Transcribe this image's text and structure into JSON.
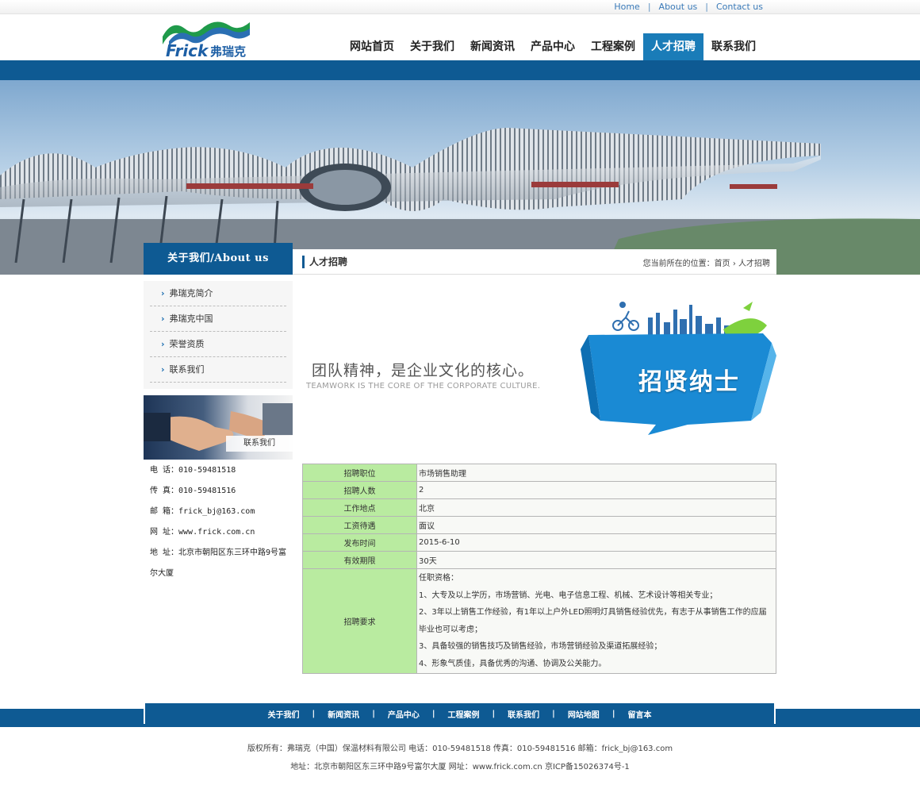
{
  "top_links": [
    "Home",
    "About us",
    "Contact us"
  ],
  "logo": {
    "text_en": "Frick",
    "text_cn": "弗瑞克"
  },
  "nav": {
    "items": [
      "网站首页",
      "关于我们",
      "新闻资讯",
      "产品中心",
      "工程案例",
      "人才招聘",
      "联系我们"
    ],
    "active_index": 5
  },
  "sidebar": {
    "title": "关于我们/About us",
    "items": [
      "弗瑞克简介",
      "弗瑞克中国",
      "荣誉资质",
      "联系我们"
    ],
    "contact_image_label": "联系我们",
    "contact": {
      "phone": "电 话：010-59481518",
      "fax": "传 真：010-59481516",
      "email": "邮 箱：frick_bj@163.com",
      "site": "网 址：www.frick.com.cn",
      "address": "地 址：北京市朝阳区东三环中路9号富尔大厦"
    }
  },
  "breadcrumb": {
    "title": "人才招聘",
    "prefix": "您当前所在的位置：",
    "home": "首页",
    "current": "人才招聘"
  },
  "recruit_banner": {
    "slogan": "团队精神，是企业文化的核心。",
    "slogan_en": "TEAMWORK IS THE CORE OF THE CORPORATE CULTURE.",
    "badge": "招贤纳士"
  },
  "job": {
    "rows": [
      {
        "label": "招聘职位",
        "value": "市场销售助理"
      },
      {
        "label": "招聘人数",
        "value": "2"
      },
      {
        "label": "工作地点",
        "value": "北京"
      },
      {
        "label": "工资待遇",
        "value": "面议"
      },
      {
        "label": "发布时间",
        "value": "2015-6-10"
      },
      {
        "label": "有效期限",
        "value": "30天"
      }
    ],
    "requirements_label": "招聘要求",
    "requirements": [
      "任职资格：",
      "1、大专及以上学历，市场营销、光电、电子信息工程、机械、艺术设计等相关专业；",
      "2、3年以上销售工作经验，有1年以上户外LED照明灯具销售经验优先，有志于从事销售工作的应届毕业也可以考虑；",
      "3、具备较强的销售技巧及销售经验，市场营销经验及渠道拓展经验；",
      "4、形象气质佳，具备优秀的沟通、协调及公关能力。"
    ]
  },
  "footer": {
    "nav": [
      "关于我们",
      "新闻资讯",
      "产品中心",
      "工程案例",
      "联系我们",
      "网站地图",
      "留言本"
    ],
    "copyright": "版权所有：弗瑞克（中国）保温材料有限公司 电话：010-59481518 传真：010-59481516 邮箱：frick_bj@163.com",
    "address": "地址：北京市朝阳区东三环中路9号富尔大厦 网址：www.frick.com.cn 京ICP备15026374号-1"
  },
  "colors": {
    "brand_blue": "#0e5a93",
    "nav_active": "#1a7cb8",
    "table_label_bg": "#b9eba0"
  }
}
